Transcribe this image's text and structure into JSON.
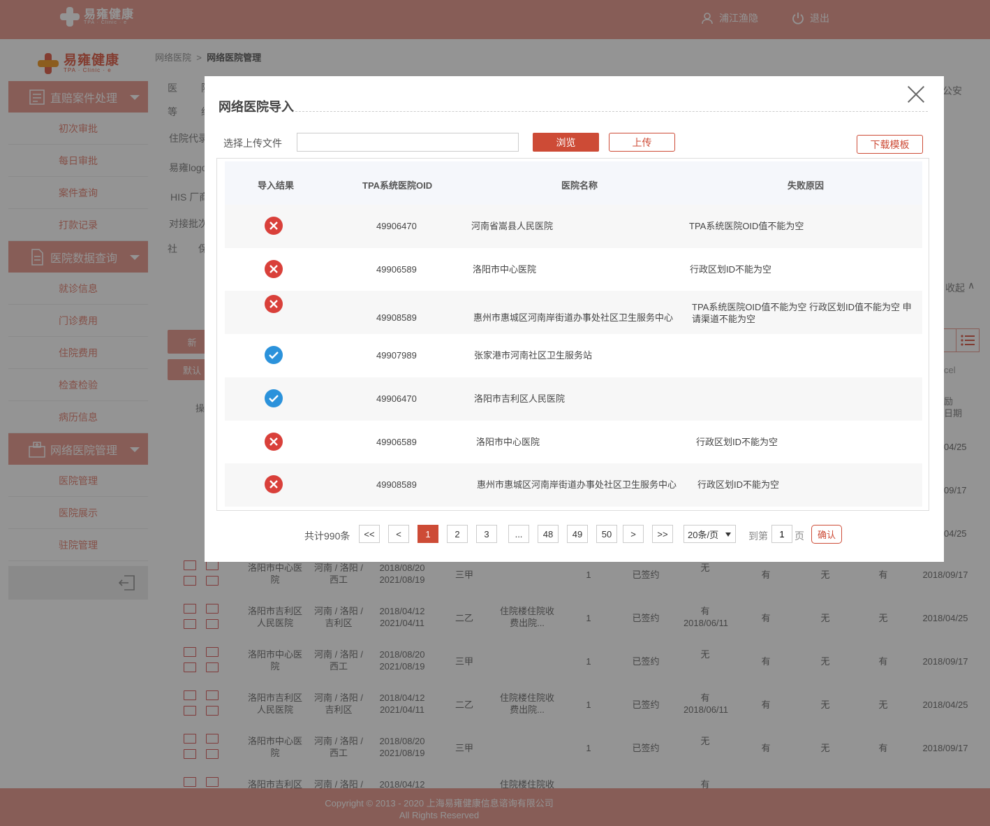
{
  "header": {
    "brand": "易雍健康",
    "brand_sub": "TPA · Clinic · e",
    "user": "浦江渔隐",
    "logout": "退出"
  },
  "sidebar": {
    "brand": "易雍健康",
    "brand_sub": "TPA · Clinic · e",
    "sections": [
      {
        "label": "直赔案件处理",
        "items": [
          "初次审批",
          "每日审批",
          "案件查询",
          "打款记录"
        ]
      },
      {
        "label": "医院数据查询",
        "items": [
          "就诊信息",
          "门诊费用",
          "住院费用",
          "检查检验",
          "病历信息"
        ]
      },
      {
        "label": "网络医院管理",
        "items": [
          "医院管理",
          "医院展示",
          "驻院管理"
        ]
      }
    ]
  },
  "breadcrumb": {
    "root": "网络医院",
    "separator": ">",
    "current": "网络医院管理"
  },
  "background": {
    "filter_labels": [
      "医",
      "院",
      "等",
      "级",
      "住院代录",
      "易雍logo",
      "HIS 厂商",
      "对接批次",
      "社",
      "保",
      "公安"
    ],
    "collapse": "收起",
    "buttons": [
      "新",
      "默认"
    ],
    "col_header": "操",
    "export_hint": "cel",
    "right_col_header": "励\n日期",
    "top_dates": [
      "04/25",
      "09/17",
      "04/25"
    ],
    "rows": [
      {
        "name": "洛阳市中心医院",
        "region": "河南 / 洛阳 / 西工",
        "d1": "2018/08/20",
        "d2": "2021/08/19",
        "level": "三甲",
        "note": "",
        "num": "1",
        "status": "已签约",
        "c1": "无",
        "c1b": "",
        "c2": "有",
        "c3": "无",
        "c4": "有",
        "date": "2018/09/17"
      },
      {
        "name": "洛阳市吉利区人民医院",
        "region": "河南 / 洛阳 / 吉利区",
        "d1": "2018/04/12",
        "d2": "2021/04/11",
        "level": "二乙",
        "note": "住院楼住院收费出院...",
        "num": "1",
        "status": "已签约",
        "c1": "有",
        "c1b": "2018/06/11",
        "c2": "有",
        "c3": "无",
        "c4": "无",
        "date": "2018/04/25"
      },
      {
        "name": "洛阳市中心医院",
        "region": "河南 / 洛阳 / 西工",
        "d1": "2018/08/20",
        "d2": "2021/08/19",
        "level": "三甲",
        "note": "",
        "num": "1",
        "status": "已签约",
        "c1": "无",
        "c1b": "",
        "c2": "有",
        "c3": "无",
        "c4": "有",
        "date": "2018/09/17"
      },
      {
        "name": "洛阳市吉利区人民医院",
        "region": "河南 / 洛阳 / 吉利区",
        "d1": "2018/04/12",
        "d2": "2021/04/11",
        "level": "二乙",
        "note": "住院楼住院收费出院...",
        "num": "1",
        "status": "已签约",
        "c1": "有",
        "c1b": "2018/06/11",
        "c2": "有",
        "c3": "无",
        "c4": "无",
        "date": "2018/04/25"
      },
      {
        "name": "洛阳市中心医院",
        "region": "河南 / 洛阳 / 西工",
        "d1": "2018/08/20",
        "d2": "2021/08/19",
        "level": "三甲",
        "note": "",
        "num": "1",
        "status": "已签约",
        "c1": "无",
        "c1b": "",
        "c2": "有",
        "c3": "无",
        "c4": "有",
        "date": "2018/09/17"
      },
      {
        "name": "洛阳市吉利区",
        "region": "河南 / 洛阳 /",
        "d1": "2018/04/12",
        "d2": "",
        "level": "",
        "note": "住院楼住院收",
        "num": "",
        "status": "",
        "c1": "有",
        "c1b": "",
        "c2": "",
        "c3": "",
        "c4": "",
        "date": ""
      }
    ]
  },
  "modal": {
    "title": "网络医院导入",
    "file_label": "选择上传文件",
    "file_value": "",
    "browse": "浏览",
    "upload": "上传",
    "template": "下载模板",
    "columns": [
      "导入结果",
      "TPA系统医院OID",
      "医院名称",
      "失败原因"
    ],
    "rows": [
      {
        "ok": false,
        "oid": "49906470",
        "name": "河南省嵩县人民医院",
        "reason": "TPA系统医院OID值不能为空"
      },
      {
        "ok": false,
        "oid": "49906589",
        "name": "洛阳市中心医院",
        "reason": "行政区划ID不能为空"
      },
      {
        "ok": false,
        "oid": "49908589",
        "name": "惠州市惠城区河南岸街道办事处社区卫生服务中心",
        "reason": "TPA系统医院OID值不能为空 行政区划ID值不能为空 申请渠道不能为空"
      },
      {
        "ok": true,
        "oid": "49907989",
        "name": "张家港市河南社区卫生服务站",
        "reason": ""
      },
      {
        "ok": true,
        "oid": "49906470",
        "name": "洛阳市吉利区人民医院",
        "reason": ""
      },
      {
        "ok": false,
        "oid": "49906589",
        "name": "洛阳市中心医院",
        "reason": "行政区划ID不能为空"
      },
      {
        "ok": false,
        "oid": "49908589",
        "name": "惠州市惠城区河南岸街道办事处社区卫生服务中心",
        "reason": "行政区划ID不能为空"
      }
    ],
    "pagination": {
      "total": "共计990条",
      "first": "<<",
      "prev": "<",
      "pages": [
        "1",
        "2",
        "3",
        "...",
        "48",
        "49",
        "50"
      ],
      "current": "1",
      "next": ">",
      "last": ">>",
      "page_size": "20条/页",
      "goto_prefix": "到第",
      "goto_value": "1",
      "goto_suffix": "页",
      "confirm": "确认"
    }
  },
  "footer": {
    "line1": "Copyright © 2013 - 2020 上海易雍健康信息谘询有限公司",
    "line2": "All Rights Reserved"
  },
  "colors": {
    "accent": "#e8a196",
    "primary": "#cd4b36",
    "fail": "#d9403a",
    "success": "#2b92db"
  }
}
